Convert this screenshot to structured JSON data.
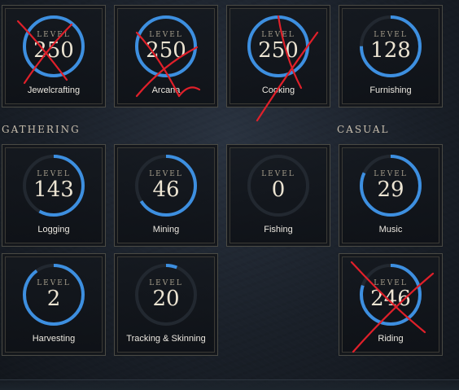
{
  "level_word": "LEVEL",
  "sections": {
    "gathering": "GATHERING",
    "casual": "CASUAL"
  },
  "cards": {
    "jewelcrafting": {
      "name": "Jewelcrafting",
      "level": "250",
      "progress": 1.0
    },
    "arcana": {
      "name": "Arcana",
      "level": "250",
      "progress": 1.0
    },
    "cooking": {
      "name": "Cooking",
      "level": "250",
      "progress": 1.0
    },
    "furnishing": {
      "name": "Furnishing",
      "level": "128",
      "progress": 0.75
    },
    "logging": {
      "name": "Logging",
      "level": "143",
      "progress": 0.58
    },
    "mining": {
      "name": "Mining",
      "level": "46",
      "progress": 0.66
    },
    "fishing": {
      "name": "Fishing",
      "level": "0",
      "progress": 0.0
    },
    "music": {
      "name": "Music",
      "level": "29",
      "progress": 0.82
    },
    "harvesting": {
      "name": "Harvesting",
      "level": "2",
      "progress": 0.9
    },
    "tracking": {
      "name": "Tracking & Skinning",
      "level": "20",
      "progress": 0.06
    },
    "riding": {
      "name": "Riding",
      "level": "246",
      "progress": 0.8
    }
  },
  "colors": {
    "progress": "#3d8fe0",
    "track": "#222830",
    "cross": "#e0202a"
  }
}
